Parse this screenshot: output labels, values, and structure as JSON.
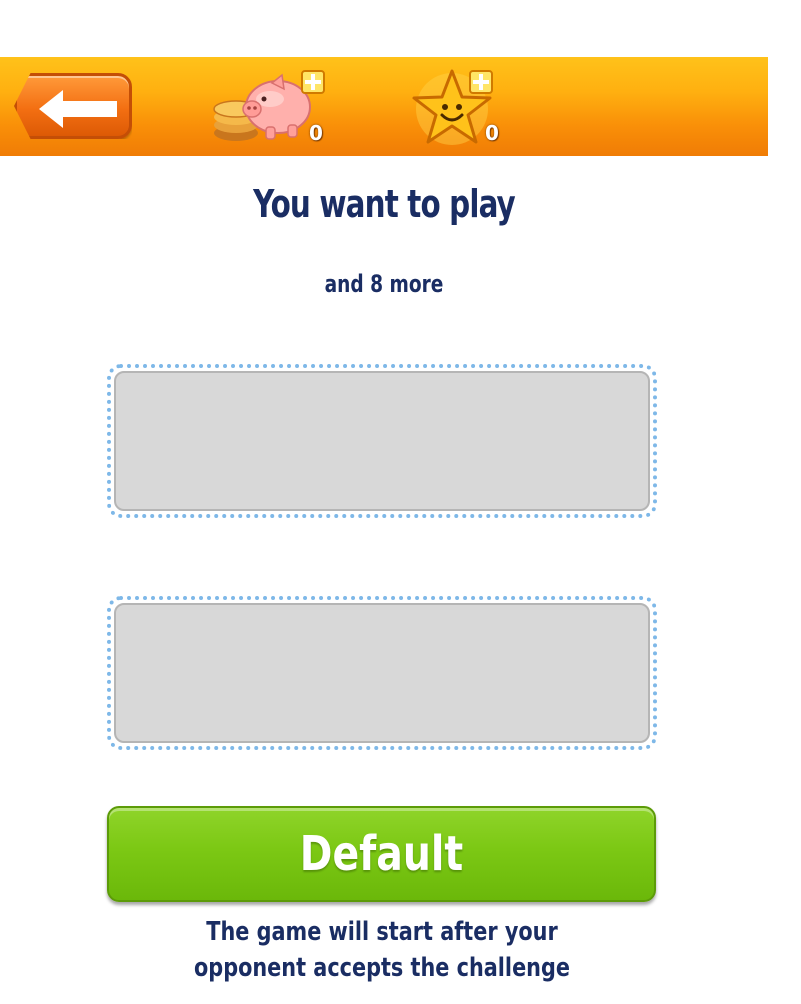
{
  "header": {
    "coins_count": "0",
    "stars_count": "0"
  },
  "main": {
    "title": "You want to play",
    "subtitle": "and 8 more",
    "default_button_label": "Default",
    "footnote": "The game will start after your opponent accepts the challenge"
  },
  "colors": {
    "header_orange": "#f98f08",
    "title_navy": "#1a2d63",
    "button_green": "#7cc814",
    "slot_border": "#7eb8e8",
    "slot_fill": "#d8d8d8"
  },
  "icons": {
    "back": "arrow-left-icon",
    "coins": "piggy-bank-icon",
    "stars": "smiling-star-icon"
  }
}
